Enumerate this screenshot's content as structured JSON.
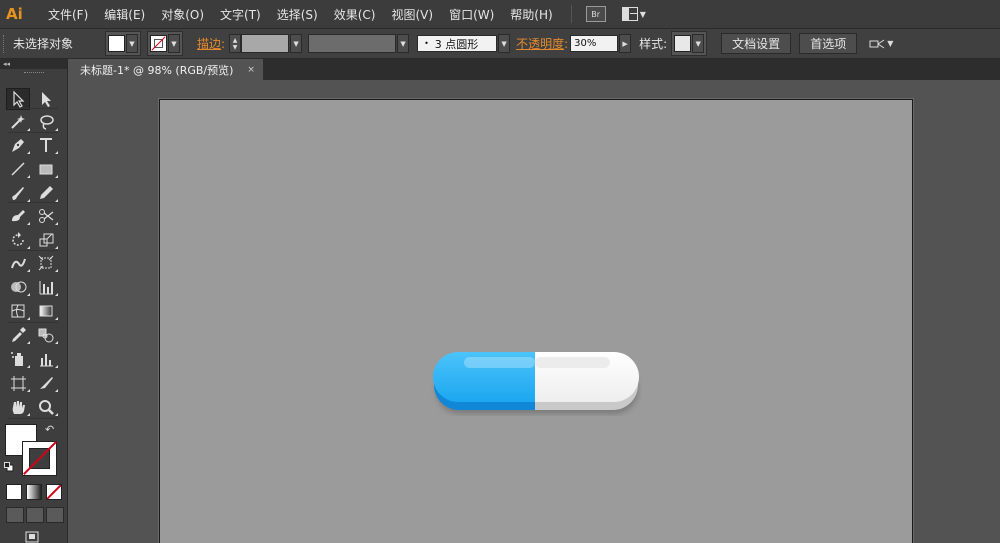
{
  "app": {
    "logo": "Ai"
  },
  "menu": [
    "文件(F)",
    "编辑(E)",
    "对象(O)",
    "文字(T)",
    "选择(S)",
    "效果(C)",
    "视图(V)",
    "窗口(W)",
    "帮助(H)"
  ],
  "menu_extra": {
    "bridge": "Br"
  },
  "controlbar": {
    "selection_label": "未选择对象",
    "stroke_label": "描边",
    "stroke_colon": ":",
    "brush_dot": "•",
    "brush_value": "3 点圆形",
    "opacity_label": "不透明度",
    "opacity_colon": ":",
    "opacity_value": "30%",
    "style_label": "样式:",
    "doc_setup": "文档设置",
    "preferences": "首选项"
  },
  "tab": {
    "title": "未标题-1* @ 98% (RGB/预览)",
    "close": "×"
  },
  "tools_header": "◂◂",
  "colors": {
    "pill_blue": "#1eaaf1",
    "pill_blue_dark": "#1187d8",
    "pill_white": "#f5f5f5",
    "pill_gray": "#cfcfcf",
    "artboard": "#9b9b9b",
    "accent_orange": "#e38b2c"
  },
  "icons": [
    "selection-icon",
    "direct-selection-icon",
    "magic-wand-icon",
    "lasso-icon",
    "pen-icon",
    "type-icon",
    "line-icon",
    "rectangle-icon",
    "paintbrush-icon",
    "pencil-icon",
    "blob-brush-icon",
    "scissors-icon",
    "rotate-icon",
    "scale-icon",
    "warp-icon",
    "free-transform-icon",
    "shape-builder-icon",
    "graph-icon",
    "mesh-icon",
    "gradient-icon",
    "eyedropper-icon",
    "blend-icon",
    "symbol-sprayer-icon",
    "column-graph-icon",
    "artboard-icon",
    "slice-icon",
    "hand-icon",
    "zoom-icon"
  ]
}
